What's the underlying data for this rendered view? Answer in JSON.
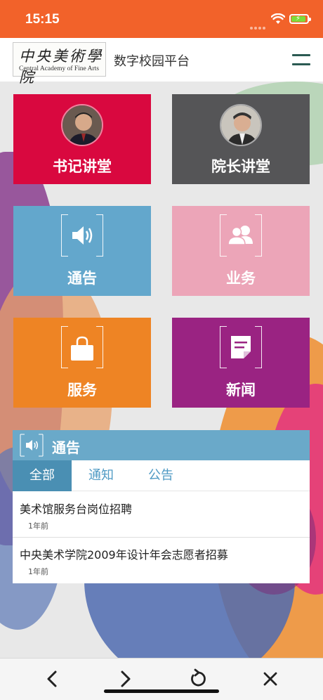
{
  "status_bar": {
    "time": "15:15"
  },
  "header": {
    "logo_cn": "中央美術學院",
    "logo_en": "Central Academy of Fine Arts",
    "title": "数字校园平台"
  },
  "tiles": [
    {
      "label": "书记讲堂",
      "color": "#d9083f",
      "icon": "portrait-avatar"
    },
    {
      "label": "院长讲堂",
      "color": "#555557",
      "icon": "portrait-avatar"
    },
    {
      "label": "通告",
      "color": "#63a7cc",
      "icon": "speaker-icon"
    },
    {
      "label": "业务",
      "color": "#eca5b8",
      "icon": "users-icon"
    },
    {
      "label": "服务",
      "color": "#ee8424",
      "icon": "bag-icon"
    },
    {
      "label": "新闻",
      "color": "#9a2382",
      "icon": "note-icon"
    }
  ],
  "notice_panel": {
    "title": "通告",
    "tabs": [
      "全部",
      "通知",
      "公告"
    ],
    "active_tab": "全部",
    "items": [
      {
        "title": "美术馆服务台岗位招聘",
        "time": "1年前"
      },
      {
        "title": "中央美术学院2009年设计年会志愿者招募",
        "time": "1年前"
      }
    ]
  },
  "toolbar": {
    "buttons": [
      "back-icon",
      "forward-icon",
      "reload-icon",
      "close-icon"
    ]
  },
  "colors": {
    "status_bar": "#f2622a",
    "notice_header": "#6aa9c9",
    "active_tab": "#4a8fb3",
    "tab_text": "#4f9ac4"
  }
}
